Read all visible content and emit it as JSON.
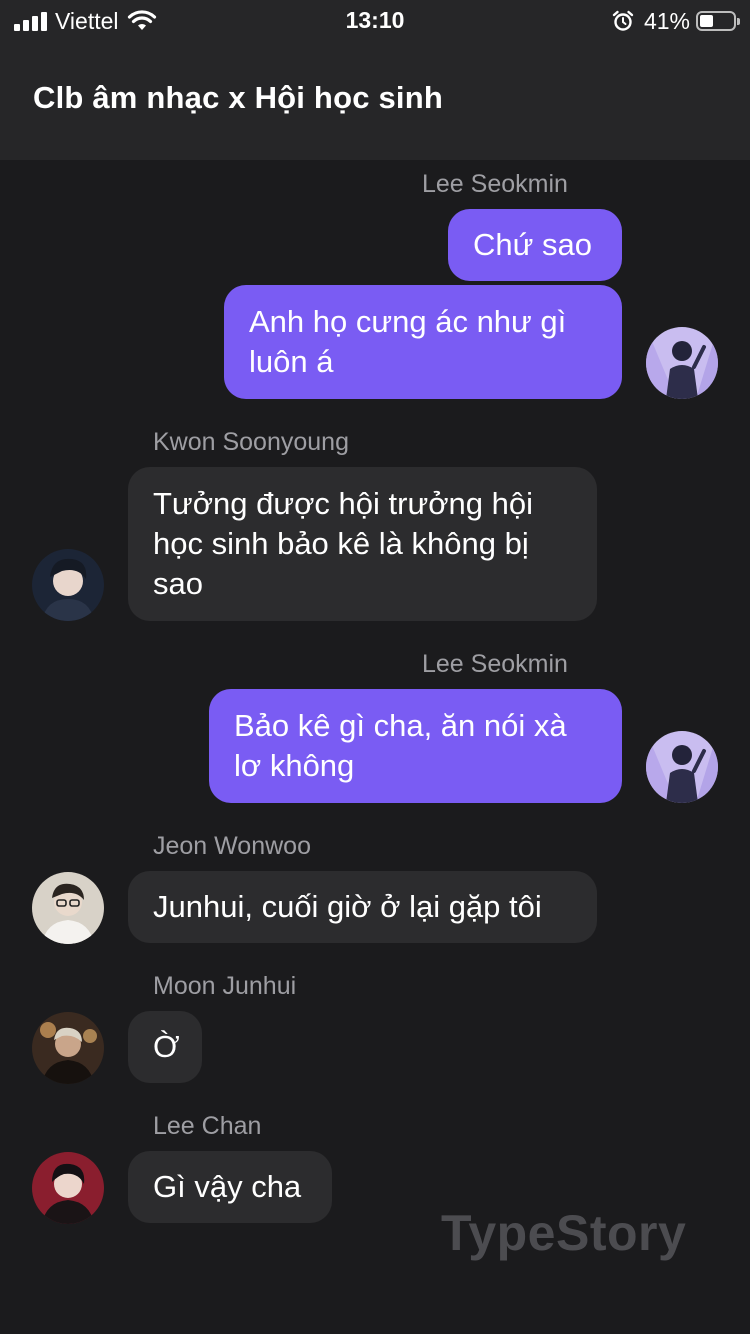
{
  "status_bar": {
    "carrier": "Viettel",
    "time": "13:10",
    "battery_percent_text": "41%",
    "battery_level": 0.41
  },
  "header": {
    "title": "Clb âm nhạc x Hội học sinh"
  },
  "messages": [
    {
      "sender": "Lee Seokmin",
      "direction": "outgoing",
      "lines": [
        "Chứ sao"
      ]
    },
    {
      "sender": "Lee Seokmin",
      "direction": "outgoing",
      "lines": [
        "Anh họ cưng ác như gì",
        "luôn á"
      ]
    },
    {
      "sender": "Kwon Soonyoung",
      "direction": "incoming",
      "lines": [
        "Tưởng được hội trưởng hội",
        "học sinh bảo kê là không bị",
        "sao"
      ]
    },
    {
      "sender": "Lee Seokmin",
      "direction": "outgoing",
      "lines": [
        "Bảo kê gì cha, ăn nói xà",
        "lơ không"
      ]
    },
    {
      "sender": "Jeon Wonwoo",
      "direction": "incoming",
      "lines": [
        "Junhui, cuối giờ ở lại gặp tôi"
      ]
    },
    {
      "sender": "Moon Junhui",
      "direction": "incoming",
      "lines": [
        "Ờ"
      ]
    },
    {
      "sender": "Lee Chan",
      "direction": "incoming",
      "lines": [
        "Gì vậy cha"
      ]
    }
  ],
  "watermark": "TypeStory",
  "colors": {
    "background": "#1b1b1d",
    "header": "#262628",
    "outgoing_bubble": "#7a5cf3",
    "incoming_bubble": "#2c2c2e",
    "sender_name": "#9e9ea3"
  }
}
